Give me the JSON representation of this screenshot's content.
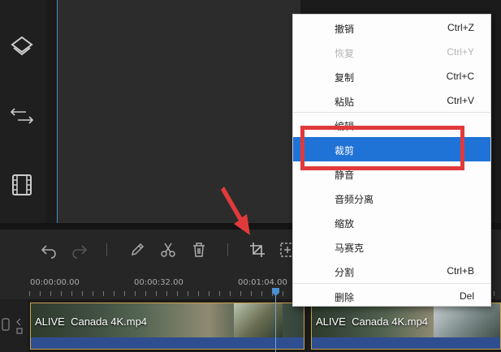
{
  "menu": {
    "items": [
      {
        "label": "撤销",
        "shortcut": "Ctrl+Z",
        "state": "normal"
      },
      {
        "label": "恢复",
        "shortcut": "Ctrl+Y",
        "state": "disabled"
      },
      {
        "label": "复制",
        "shortcut": "Ctrl+C",
        "state": "normal"
      },
      {
        "label": "粘贴",
        "shortcut": "Ctrl+V",
        "state": "normal"
      },
      {
        "label": "编辑",
        "shortcut": "",
        "state": "normal"
      },
      {
        "label": "裁剪",
        "shortcut": "",
        "state": "active"
      },
      {
        "label": "静音",
        "shortcut": "",
        "state": "normal"
      },
      {
        "label": "音频分离",
        "shortcut": "",
        "state": "normal"
      },
      {
        "label": "缩放",
        "shortcut": "",
        "state": "normal"
      },
      {
        "label": "马赛克",
        "shortcut": "",
        "state": "normal"
      },
      {
        "label": "分割",
        "shortcut": "Ctrl+B",
        "state": "normal"
      },
      {
        "label": "删除",
        "shortcut": "Del",
        "state": "normal"
      }
    ]
  },
  "ruler": {
    "ticks": [
      "00:00:00.00",
      "00:00:32.00",
      "00:01:04.00"
    ]
  },
  "timeline": {
    "clips": [
      {
        "title": "ALIVE  Canada 4K.mp4"
      },
      {
        "title": "ALIVE  Canada 4K.mp4"
      }
    ]
  },
  "colors": {
    "highlight": "#e13a3a",
    "menu_active": "#1f72d6",
    "playhead": "#4a8fd0",
    "clip_border": "#c9a44d"
  },
  "icons": {
    "rail": [
      "layers-icon",
      "transition-icon",
      "film-icon"
    ],
    "toolbar": [
      "undo-icon",
      "redo-icon",
      "pencil-icon",
      "scissors-icon",
      "trash-icon",
      "crop-icon",
      "add-frame-icon"
    ]
  }
}
